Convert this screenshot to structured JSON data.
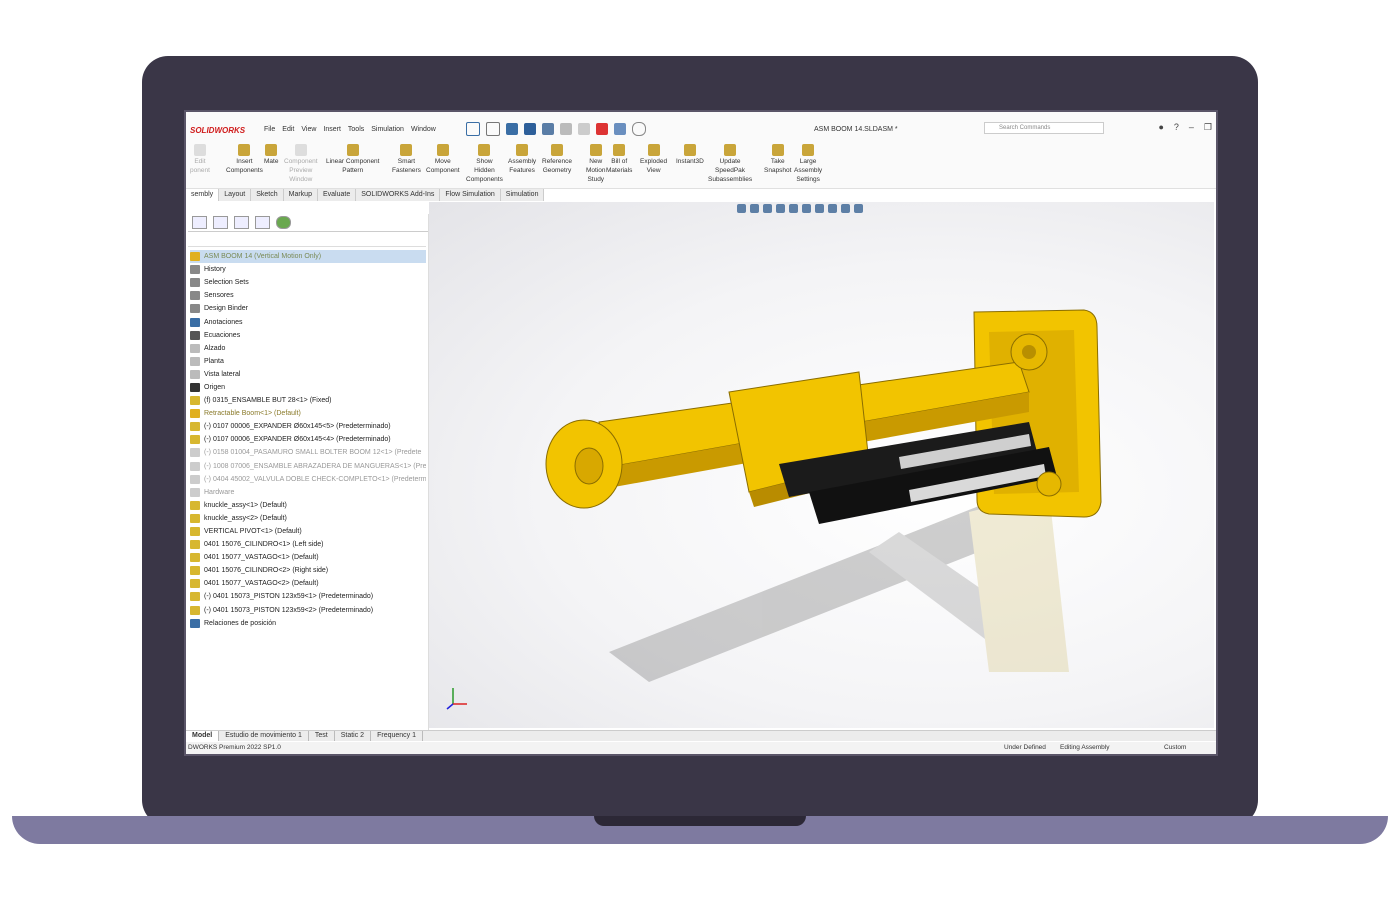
{
  "app": {
    "logo": "SOLIDWORKS",
    "document_title": "ASM BOOM 14.SLDASM *"
  },
  "menu": [
    "File",
    "Edit",
    "View",
    "Insert",
    "Tools",
    "Simulation",
    "Window"
  ],
  "search": {
    "placeholder": "Search Commands"
  },
  "ribbon": [
    {
      "label": "Edit\nponent",
      "dim": true
    },
    {
      "label": "Insert\nComponents"
    },
    {
      "label": "Mate"
    },
    {
      "label": "Component\nPreview\nWindow",
      "dim": true
    },
    {
      "label": "Linear Component\nPattern"
    },
    {
      "label": "Smart\nFasteners"
    },
    {
      "label": "Move\nComponent"
    },
    {
      "label": "Show\nHidden\nComponents"
    },
    {
      "label": "Assembly\nFeatures"
    },
    {
      "label": "Reference\nGeometry"
    },
    {
      "label": "New\nMotion\nStudy"
    },
    {
      "label": "Bill of\nMaterials"
    },
    {
      "label": "Exploded\nView"
    },
    {
      "label": "Instant3D"
    },
    {
      "label": "Update\nSpeedPak\nSubassemblies"
    },
    {
      "label": "Take\nSnapshot"
    },
    {
      "label": "Large\nAssembly\nSettings"
    }
  ],
  "command_tabs": [
    "sembly",
    "Layout",
    "Sketch",
    "Markup",
    "Evaluate",
    "SOLIDWORKS Add-Ins",
    "Flow Simulation",
    "Simulation"
  ],
  "tree": [
    {
      "label": "ASM BOOM 14 (Vertical Motion Only)",
      "state": "sel",
      "color": "#e0b020"
    },
    {
      "label": "History",
      "color": "#888"
    },
    {
      "label": "Selection Sets",
      "color": "#888"
    },
    {
      "label": "Sensores",
      "color": "#888"
    },
    {
      "label": "Design Binder",
      "color": "#888"
    },
    {
      "label": "Anotaciones",
      "color": "#3a6ea5"
    },
    {
      "label": "Ecuaciones",
      "color": "#555"
    },
    {
      "label": "Alzado",
      "color": "#bbb"
    },
    {
      "label": "Planta",
      "color": "#bbb"
    },
    {
      "label": "Vista lateral",
      "color": "#bbb"
    },
    {
      "label": "Origen",
      "color": "#333"
    },
    {
      "label": "(f) 0315_ENSAMBLE BUT 28<1> (Fixed)",
      "color": "#d7b730"
    },
    {
      "label": "Retractable Boom<1> (Default)",
      "state": "warn",
      "color": "#e0b020"
    },
    {
      "label": "(-) 0107 00006_EXPANDER Ø60x145<5> (Predeterminado)",
      "color": "#d7b730"
    },
    {
      "label": "(-) 0107 00006_EXPANDER Ø60x145<4> (Predeterminado)",
      "color": "#d7b730"
    },
    {
      "label": "(-) 0158 01004_PASAMURO SMALL BOLTER BOOM 12<1> (Predete",
      "state": "dim",
      "color": "#ccc"
    },
    {
      "label": "(-) 1008 07006_ENSAMBLE ABRAZADERA DE MANGUERAS<1> (Pre",
      "state": "dim",
      "color": "#ccc"
    },
    {
      "label": "(-) 0404 45002_VALVULA DOBLE CHECK-COMPLETO<1> (Predeterm",
      "state": "dim",
      "color": "#ccc"
    },
    {
      "label": "Hardware",
      "state": "dim",
      "color": "#ccc"
    },
    {
      "label": "knuckle_assy<1> (Default)",
      "color": "#d7b730"
    },
    {
      "label": "knuckle_assy<2> (Default)",
      "color": "#d7b730"
    },
    {
      "label": "VERTICAL PIVOT<1> (Default)",
      "color": "#d7b730"
    },
    {
      "label": "0401 15076_CILINDRO<1> (Left side)",
      "color": "#d7b730"
    },
    {
      "label": "0401 15077_VASTAGO<1> (Default)",
      "color": "#d7b730"
    },
    {
      "label": "0401 15076_CILINDRO<2> (Right side)",
      "color": "#d7b730"
    },
    {
      "label": "0401 15077_VASTAGO<2> (Default)",
      "color": "#d7b730"
    },
    {
      "label": "(-) 0401 15073_PISTON 123x59<1> (Predeterminado)",
      "color": "#d7b730"
    },
    {
      "label": "(-) 0401 15073_PISTON 123x59<2> (Predeterminado)",
      "color": "#d7b730"
    },
    {
      "label": "Relaciones de posición",
      "color": "#3a6ea5"
    }
  ],
  "bottom_tabs": [
    "Model",
    "Estudio de movimiento 1",
    "Test",
    "Static 2",
    "Frequency 1"
  ],
  "status": {
    "version": "DWORKS Premium 2022 SP1.0",
    "defined": "Under Defined",
    "mode": "Editing Assembly",
    "units": "Custom"
  },
  "colors": {
    "part": "#f2c400",
    "part_dark": "#c99a00",
    "cylinder": "#1b1b1b",
    "frame": "#3a3647"
  }
}
